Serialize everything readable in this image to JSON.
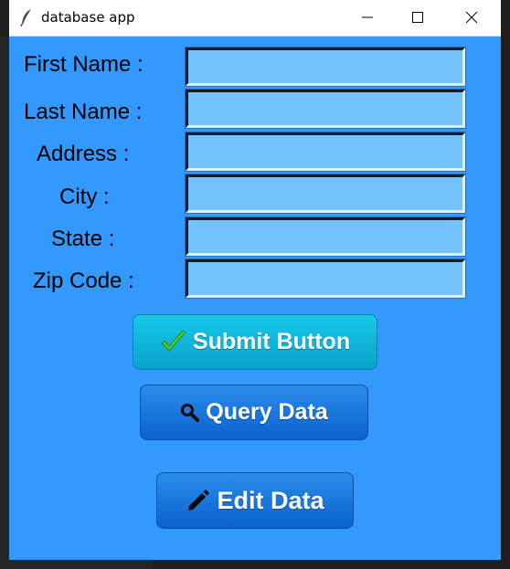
{
  "window": {
    "title": "database app"
  },
  "form": {
    "fields": [
      {
        "label": "First Name :",
        "value": ""
      },
      {
        "label": "Last Name :",
        "value": ""
      },
      {
        "label": "Address :",
        "value": ""
      },
      {
        "label": "City :",
        "value": ""
      },
      {
        "label": "State :",
        "value": ""
      },
      {
        "label": "Zip Code :",
        "value": ""
      }
    ]
  },
  "buttons": {
    "submit": {
      "label": "Submit Button",
      "icon": "checkmark-icon"
    },
    "query": {
      "label": "Query Data",
      "icon": "search-icon"
    },
    "edit": {
      "label": "Edit Data",
      "icon": "pencil-icon"
    }
  },
  "colors": {
    "window_bg": "#3399ff",
    "field_bg": "#74c2fb",
    "submit_bg": "#17c8e9",
    "action_bg": "#0b62d0"
  }
}
